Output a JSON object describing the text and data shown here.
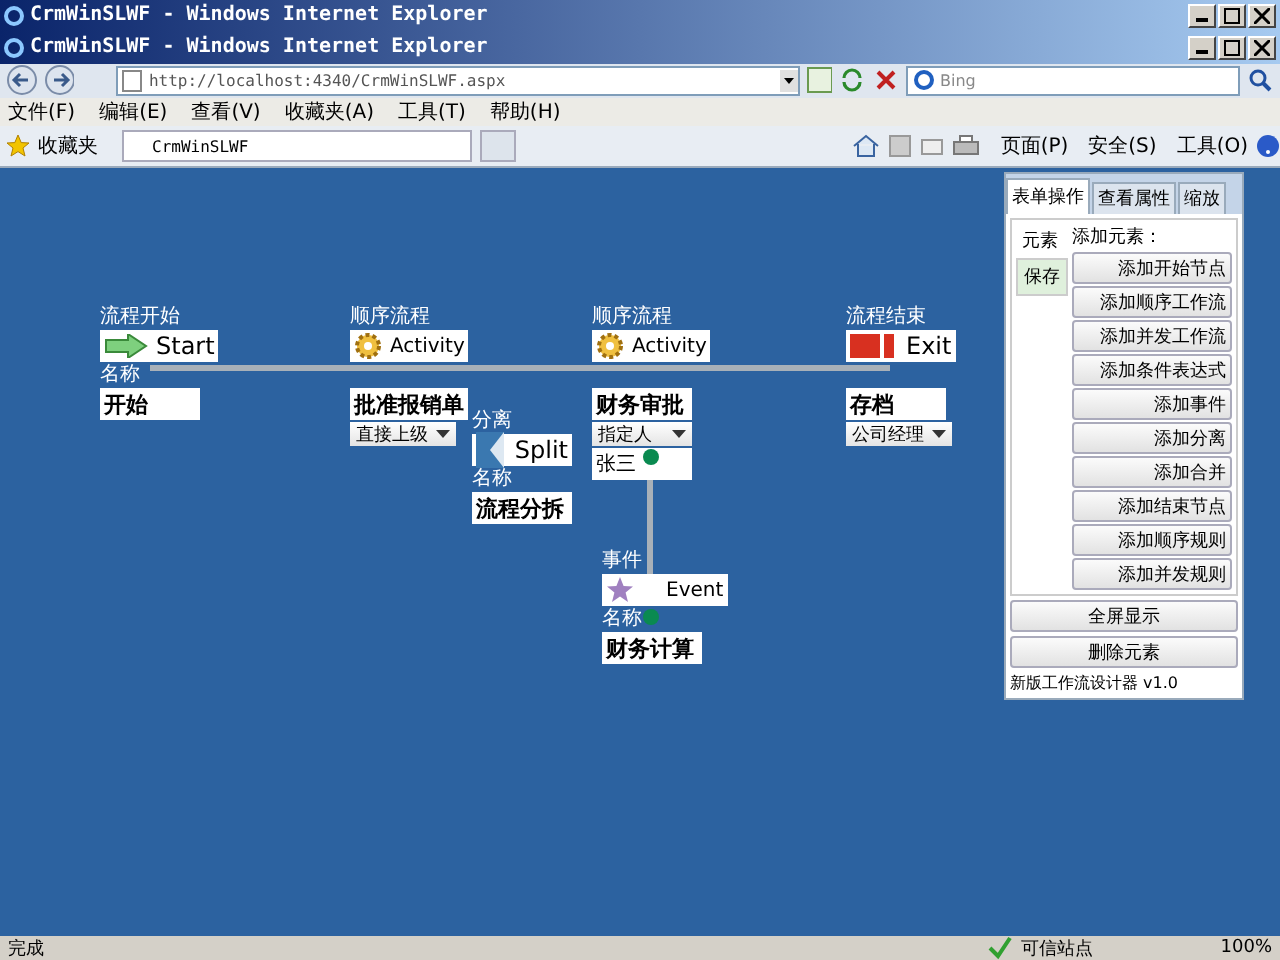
{
  "back_window": {
    "title": "CrmWinSLWF - Windows Internet Explorer"
  },
  "window": {
    "title": "CrmWinSLWF - Windows Internet Explorer"
  },
  "address_bar": {
    "url": "http://localhost:4340/CrmWinSLWF.aspx"
  },
  "search": {
    "placeholder": "Bing"
  },
  "menu": [
    "文件(F)",
    "编辑(E)",
    "查看(V)",
    "收藏夹(A)",
    "工具(T)",
    "帮助(H)"
  ],
  "favorites": {
    "label": "收藏夹",
    "tab": "CrmWinSLWF",
    "commands": [
      "页面(P)",
      "安全(S)",
      "工具(O)"
    ]
  },
  "nodes": [
    {
      "kind": "start",
      "title": "流程开始",
      "box_label": "Start",
      "name_label": "名称",
      "name": "开始"
    },
    {
      "kind": "activity",
      "title": "顺序流程",
      "box_label": "Activity",
      "name": "批准报销单",
      "dropdown": "直接上级"
    },
    {
      "kind": "split",
      "title": "分离",
      "box_label": "Split",
      "name_label": "名称",
      "name": "流程分拆"
    },
    {
      "kind": "activity",
      "title": "顺序流程",
      "box_label": "Activity",
      "name": "财务审批",
      "dropdown": "指定人",
      "assignee": "张三"
    },
    {
      "kind": "exit",
      "title": "流程结束",
      "box_label": "Exit",
      "name": "存档",
      "dropdown": "公司经理"
    },
    {
      "kind": "event",
      "title": "事件",
      "box_label": "Event",
      "name_label": "名称",
      "name": "财务计算"
    }
  ],
  "panel": {
    "tabs": [
      {
        "label": "表单操作",
        "selected": true
      },
      {
        "label": "查看属性",
        "selected": false
      },
      {
        "label": "缩放",
        "selected": false
      }
    ],
    "side_tabs": [
      {
        "label": "元素",
        "selected": true
      },
      {
        "label": "保存",
        "selected": false
      }
    ],
    "heading": "添加元素：",
    "buttons": [
      "添加开始节点",
      "添加顺序工作流",
      "添加并发工作流",
      "添加条件表达式",
      "添加事件",
      "添加分离",
      "添加合并",
      "添加结束节点",
      "添加顺序规则",
      "添加并发规则"
    ],
    "bottom_buttons": [
      "全屏显示",
      "删除元素"
    ],
    "footer": "新版工作流设计器 v1.0"
  },
  "status_bar": {
    "text": "完成",
    "zone": "可信站点",
    "zoom": "100%"
  }
}
